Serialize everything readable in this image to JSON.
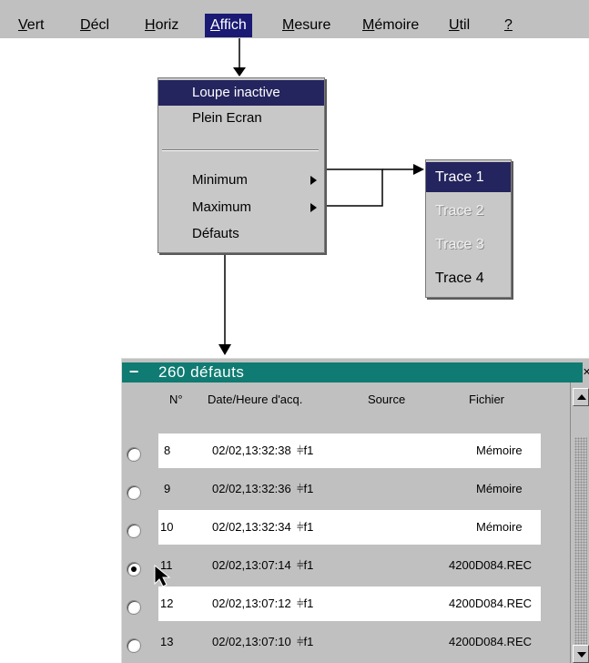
{
  "menubar": {
    "items": [
      {
        "pre": "",
        "u": "V",
        "post": "ert"
      },
      {
        "pre": "",
        "u": "D",
        "post": "écl"
      },
      {
        "pre": "",
        "u": "H",
        "post": "oriz"
      },
      {
        "pre": "",
        "u": "A",
        "post": "ffich"
      },
      {
        "pre": "",
        "u": "M",
        "post": "esure"
      },
      {
        "pre": "",
        "u": "M",
        "post": "émoire"
      },
      {
        "pre": "",
        "u": "U",
        "post": "til"
      },
      {
        "pre": "",
        "u": "?",
        "post": ""
      }
    ]
  },
  "affich_menu": {
    "items": [
      "Loupe inactive",
      "Plein Ecran",
      "Minimum",
      "Maximum",
      "Défauts"
    ]
  },
  "trace_menu": {
    "items": [
      "Trace 1",
      "Trace 2",
      "Trace 3",
      "Trace 4"
    ]
  },
  "defauts_window": {
    "title": "260 défauts",
    "columns": [
      "N°",
      "Date/Heure d'acq.",
      "Source",
      "Fichier"
    ],
    "rows": [
      {
        "n": "8",
        "date": "02/02,13:32:38",
        "source": "⫩f1",
        "file": "Mémoire"
      },
      {
        "n": "9",
        "date": "02/02,13:32:36",
        "source": "⫩f1",
        "file": "Mémoire"
      },
      {
        "n": "10",
        "date": "02/02,13:32:34",
        "source": "⫩f1",
        "file": "Mémoire"
      },
      {
        "n": "11",
        "date": "02/02,13:07:14",
        "source": "⫩f1",
        "file": "4200D084.REC"
      },
      {
        "n": "12",
        "date": "02/02,13:07:12",
        "source": "⫩f1",
        "file": "4200D084.REC"
      },
      {
        "n": "13",
        "date": "02/02,13:07:10",
        "source": "⫩f1",
        "file": "4200D084.REC"
      }
    ],
    "selected_row": "11"
  },
  "colors": {
    "menubar_bg": "#c0c0c0",
    "highlight": "#24245e",
    "title_bar": "#0f7b72"
  }
}
